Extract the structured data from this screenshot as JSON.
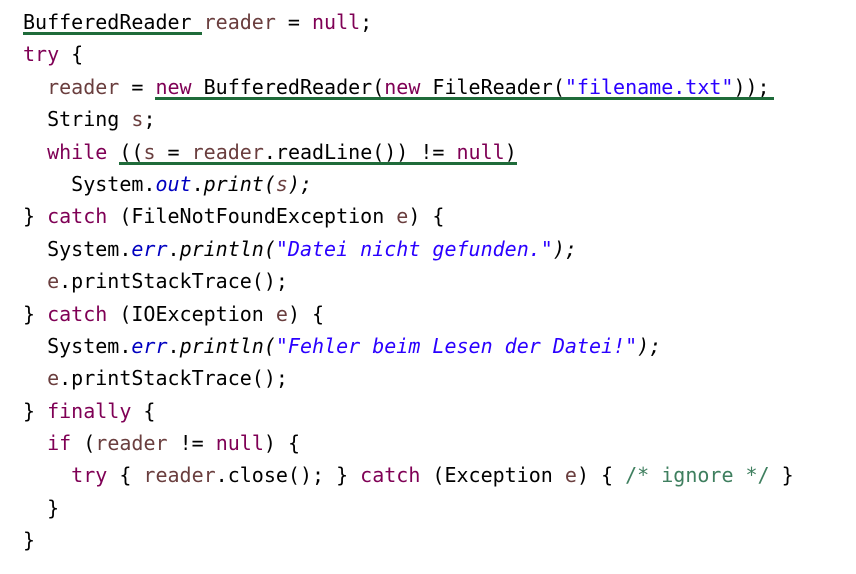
{
  "colors": {
    "keyword": "#7f0055",
    "variable": "#6a3e3e",
    "string": "#2a00ff",
    "field": "#0000c0",
    "comment": "#3f7f5f",
    "plain": "#000000",
    "underline": "#1f6b3a"
  },
  "lines": [
    {
      "indent": "",
      "tokens": [
        {
          "t": "BufferedReader",
          "c": "pl"
        },
        {
          "t": " ",
          "c": "pl"
        },
        {
          "t": "reader",
          "c": "var"
        },
        {
          "t": " = ",
          "c": "pl"
        },
        {
          "t": "null",
          "c": "kw"
        },
        {
          "t": ";",
          "c": "pl"
        }
      ]
    },
    {
      "indent": "",
      "tokens": [
        {
          "t": "try",
          "c": "kw"
        },
        {
          "t": " {",
          "c": "pl"
        }
      ]
    },
    {
      "indent": "  ",
      "tokens": [
        {
          "t": "reader",
          "c": "var"
        },
        {
          "t": " = ",
          "c": "pl"
        },
        {
          "t": "new",
          "c": "kw"
        },
        {
          "t": " BufferedReader(",
          "c": "pl"
        },
        {
          "t": "new",
          "c": "kw"
        },
        {
          "t": " FileReader(",
          "c": "pl"
        },
        {
          "t": "\"filename.txt\"",
          "c": "str"
        },
        {
          "t": "));",
          "c": "pl"
        }
      ]
    },
    {
      "indent": "  ",
      "tokens": [
        {
          "t": "String ",
          "c": "pl"
        },
        {
          "t": "s",
          "c": "var"
        },
        {
          "t": ";",
          "c": "pl"
        }
      ]
    },
    {
      "indent": "  ",
      "tokens": [
        {
          "t": "while",
          "c": "kw"
        },
        {
          "t": " ((",
          "c": "pl"
        },
        {
          "t": "s",
          "c": "var"
        },
        {
          "t": " = ",
          "c": "pl"
        },
        {
          "t": "reader",
          "c": "var"
        },
        {
          "t": ".readLine()) != ",
          "c": "pl"
        },
        {
          "t": "null",
          "c": "kw"
        },
        {
          "t": ")",
          "c": "pl"
        }
      ]
    },
    {
      "indent": "    ",
      "tokens": [
        {
          "t": "System.",
          "c": "pl"
        },
        {
          "t": "out",
          "c": "fld"
        },
        {
          "t": ".",
          "c": "pl"
        },
        {
          "t": "print(",
          "c": "it"
        },
        {
          "t": "s",
          "c": "var it"
        },
        {
          "t": ");",
          "c": "it"
        }
      ]
    },
    {
      "indent": "",
      "tokens": [
        {
          "t": "} ",
          "c": "pl"
        },
        {
          "t": "catch",
          "c": "kw"
        },
        {
          "t": " (FileNotFoundException ",
          "c": "pl"
        },
        {
          "t": "e",
          "c": "var"
        },
        {
          "t": ") {",
          "c": "pl"
        }
      ]
    },
    {
      "indent": "  ",
      "tokens": [
        {
          "t": "System.",
          "c": "pl"
        },
        {
          "t": "err",
          "c": "fld"
        },
        {
          "t": ".",
          "c": "pl"
        },
        {
          "t": "println(",
          "c": "it"
        },
        {
          "t": "\"Datei nicht gefunden.\"",
          "c": "str it"
        },
        {
          "t": ");",
          "c": "it"
        }
      ]
    },
    {
      "indent": "  ",
      "tokens": [
        {
          "t": "e",
          "c": "var"
        },
        {
          "t": ".printStackTrace();",
          "c": "pl"
        }
      ]
    },
    {
      "indent": "",
      "tokens": [
        {
          "t": "} ",
          "c": "pl"
        },
        {
          "t": "catch",
          "c": "kw"
        },
        {
          "t": " (IOException ",
          "c": "pl"
        },
        {
          "t": "e",
          "c": "var"
        },
        {
          "t": ") {",
          "c": "pl"
        }
      ]
    },
    {
      "indent": "  ",
      "tokens": [
        {
          "t": "System.",
          "c": "pl"
        },
        {
          "t": "err",
          "c": "fld"
        },
        {
          "t": ".",
          "c": "pl"
        },
        {
          "t": "println(",
          "c": "it"
        },
        {
          "t": "\"Fehler beim Lesen der Datei!\"",
          "c": "str it"
        },
        {
          "t": ");",
          "c": "it"
        }
      ]
    },
    {
      "indent": "  ",
      "tokens": [
        {
          "t": "e",
          "c": "var"
        },
        {
          "t": ".printStackTrace();",
          "c": "pl"
        }
      ]
    },
    {
      "indent": "",
      "tokens": [
        {
          "t": "} ",
          "c": "pl"
        },
        {
          "t": "finally",
          "c": "kw"
        },
        {
          "t": " {",
          "c": "pl"
        }
      ]
    },
    {
      "indent": "  ",
      "tokens": [
        {
          "t": "if",
          "c": "kw"
        },
        {
          "t": " (",
          "c": "pl"
        },
        {
          "t": "reader",
          "c": "var"
        },
        {
          "t": " != ",
          "c": "pl"
        },
        {
          "t": "null",
          "c": "kw"
        },
        {
          "t": ") {",
          "c": "pl"
        }
      ]
    },
    {
      "indent": "    ",
      "tokens": [
        {
          "t": "try",
          "c": "kw"
        },
        {
          "t": " { ",
          "c": "pl"
        },
        {
          "t": "reader",
          "c": "var"
        },
        {
          "t": ".close(); } ",
          "c": "pl"
        },
        {
          "t": "catch",
          "c": "kw"
        },
        {
          "t": " (Exception ",
          "c": "pl"
        },
        {
          "t": "e",
          "c": "var"
        },
        {
          "t": ") { ",
          "c": "pl"
        },
        {
          "t": "/* ignore */",
          "c": "cmt"
        },
        {
          "t": " }",
          "c": "pl"
        }
      ]
    },
    {
      "indent": "  ",
      "tokens": [
        {
          "t": "}",
          "c": "pl"
        }
      ]
    },
    {
      "indent": "",
      "tokens": [
        {
          "t": "}",
          "c": "pl"
        }
      ]
    }
  ]
}
